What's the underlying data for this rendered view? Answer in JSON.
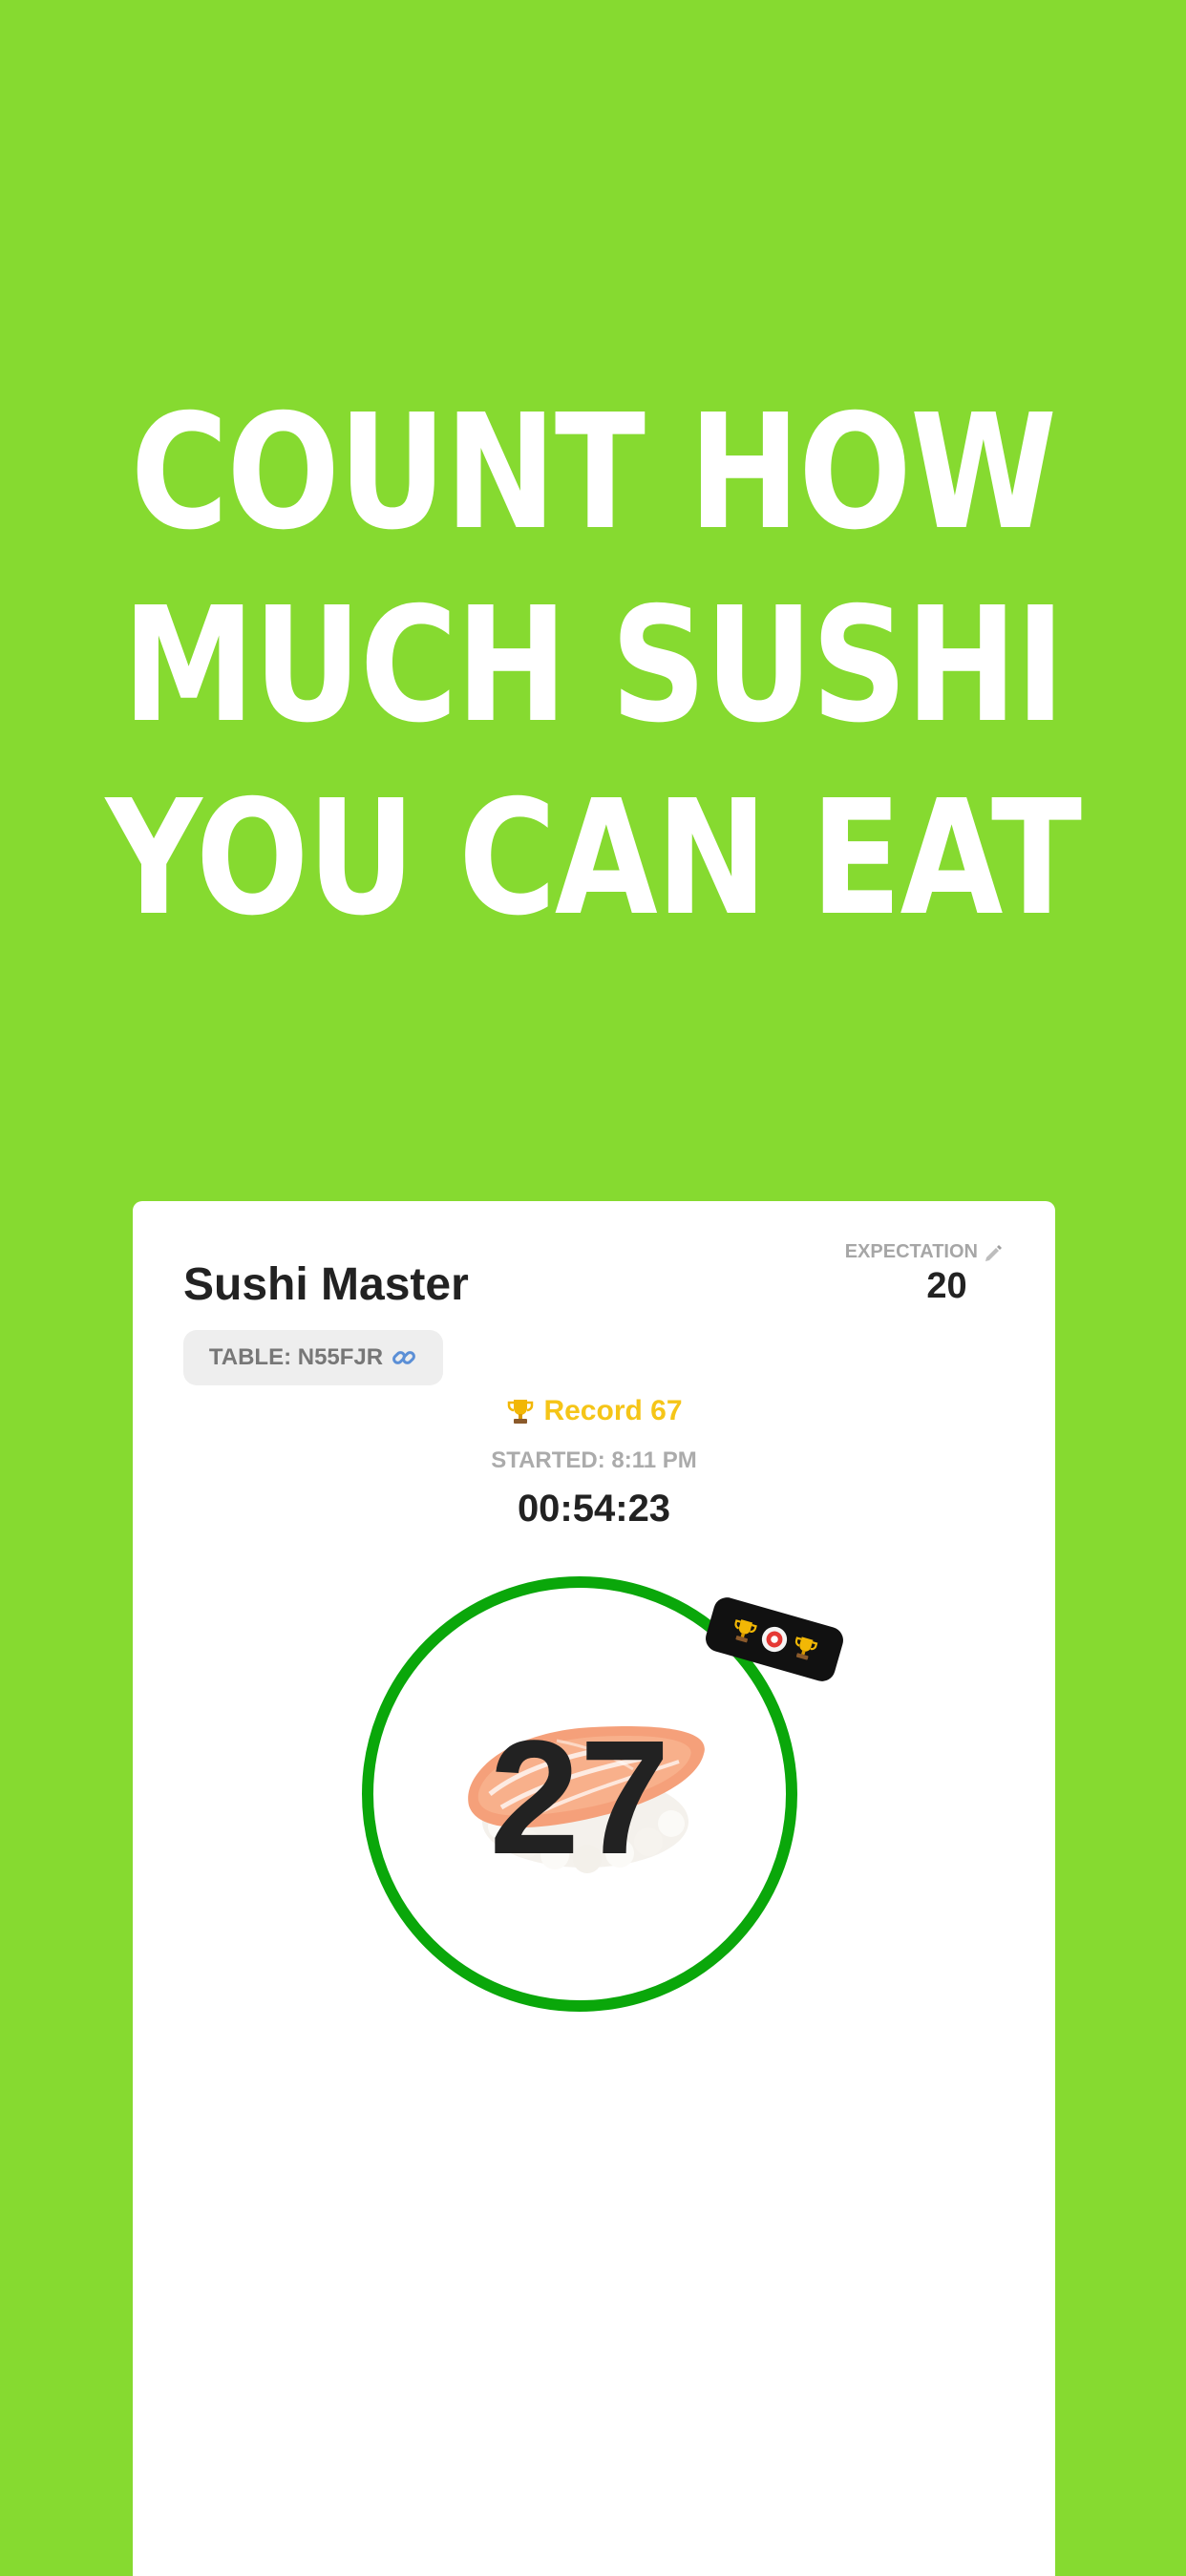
{
  "headline": {
    "line1": "COUNT HOW",
    "line2": "MUCH SUSHI",
    "line3": "YOU CAN EAT"
  },
  "app": {
    "title": "Sushi Master",
    "table_chip": "TABLE: N55FJR",
    "expectation_label": "EXPECTATION",
    "expectation_value": "20",
    "record": "Record 67",
    "started": "STARTED: 8:11 PM",
    "timer": "00:54:23",
    "count": "27"
  },
  "icons": {
    "table_link": "link-icon",
    "expectation_edit": "pencil-icon",
    "record": "trophy-icon",
    "badge": [
      "trophy-icon",
      "sushi-icon",
      "trophy-icon"
    ]
  },
  "colors": {
    "background": "#86DA30",
    "ring": "#0AA70A",
    "record": "#F5C518",
    "card": "#FFFFFF",
    "text": "#222222"
  }
}
